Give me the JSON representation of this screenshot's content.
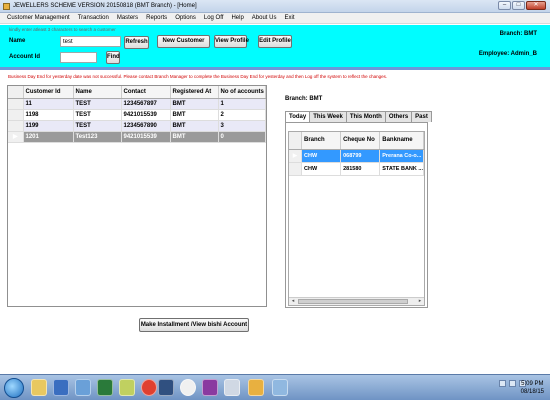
{
  "window": {
    "title": "JEWELLERS SCHEME VERSION 20150818 (BMT Branch) - [Home]",
    "minimize": "–",
    "maximize": "□",
    "close": "✕"
  },
  "menu": [
    "Customer Management",
    "Transaction",
    "Masters",
    "Reports",
    "Options",
    "Log Off",
    "Help",
    "About Us",
    "Exit"
  ],
  "header": {
    "hint": "kindly enter atleast 3 characters to search a customer",
    "name_label": "Name",
    "name_value": "test",
    "account_label": "Account Id",
    "account_value": "",
    "refresh_label": "Refresh",
    "find_label": "Find",
    "new_customer_label": "New Customer",
    "view_profile_label": "View Profile",
    "edit_profile_label": "Edit Profile",
    "branch": "Branch: BMT",
    "employee": "Employee: Admin_B"
  },
  "warning": "Business Day End for yesterday date was not successful. Please contact Branch Manager to complete the Business Day End for yesterday and then Log off the system to reflect the changes.",
  "customers": {
    "columns": [
      "Customer Id",
      "Name",
      "Contact",
      "Registered At",
      "No of accounts"
    ],
    "rows": [
      [
        "11",
        "TEST",
        "1234567897",
        "BMT",
        "1"
      ],
      [
        "1198",
        "TEST",
        "9421015539",
        "BMT",
        "2"
      ],
      [
        "1199",
        "TEST",
        "1234567890",
        "BMT",
        "3"
      ],
      [
        "1201",
        "Test123",
        "9421015539",
        "BMT",
        "0"
      ]
    ],
    "selected_marker": "▶"
  },
  "right_panel": {
    "branch_label": "Branch: BMT",
    "tabs": [
      "Today",
      "This Week",
      "This Month",
      "Others",
      "Past"
    ],
    "columns": [
      "Branch",
      "Cheque No",
      "Bankname"
    ],
    "rows": [
      [
        "CHW",
        "068799",
        "Prerana Co-o..."
      ],
      [
        "CHW",
        "281580",
        "STATE BANK ..."
      ]
    ],
    "selected_marker": "▶"
  },
  "footer": {
    "installment_button": "Make Installment /View bishi Account"
  },
  "taskbar": {
    "time": "5:09 PM",
    "date": "08/18/15"
  },
  "colors": {
    "header_bg": "#00fdff",
    "warning": "#d00000",
    "selected_row": "#9a9a9a",
    "selected_subrow": "#3399ff"
  }
}
